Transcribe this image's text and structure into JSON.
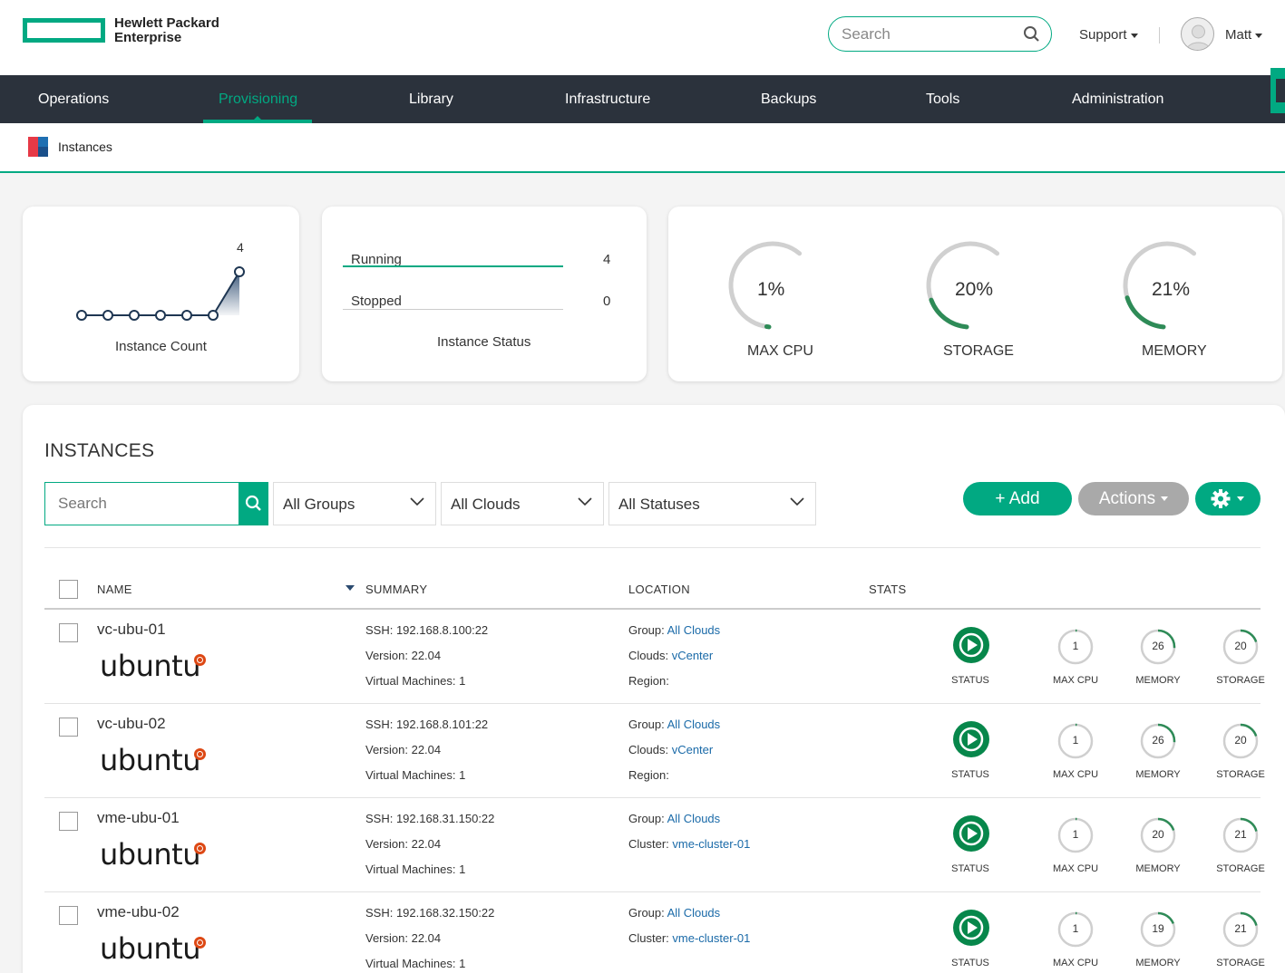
{
  "brand": {
    "line1": "Hewlett Packard",
    "line2": "Enterprise",
    "color": "#01a982"
  },
  "header": {
    "search_placeholder": "Search",
    "support_label": "Support",
    "user_name": "Matt"
  },
  "nav": {
    "items": [
      "Operations",
      "Provisioning",
      "Library",
      "Infrastructure",
      "Backups",
      "Tools",
      "Administration"
    ],
    "active": "Provisioning"
  },
  "breadcrumb": {
    "label": "Instances"
  },
  "summary": {
    "instance_count": {
      "caption": "Instance Count",
      "value_label": "4",
      "series": [
        0,
        0,
        0,
        0,
        0,
        0,
        4
      ]
    },
    "instance_status": {
      "caption": "Instance Status",
      "rows": [
        {
          "label": "Running",
          "value": "4"
        },
        {
          "label": "Stopped",
          "value": "0"
        }
      ]
    },
    "gauges": [
      {
        "label": "MAX CPU",
        "value": "1%",
        "fraction": 0.01
      },
      {
        "label": "STORAGE",
        "value": "20%",
        "fraction": 0.2
      },
      {
        "label": "MEMORY",
        "value": "21%",
        "fraction": 0.21
      }
    ]
  },
  "instances": {
    "title": "INSTANCES",
    "search_placeholder": "Search",
    "filters": {
      "groups": "All Groups",
      "clouds": "All Clouds",
      "statuses": "All Statuses"
    },
    "add_label": "+ Add",
    "actions_label": "Actions",
    "columns": {
      "name": "NAME",
      "summary": "SUMMARY",
      "location": "LOCATION",
      "stats": "STATS"
    },
    "stat_labels": {
      "status": "STATUS",
      "cpu": "MAX CPU",
      "memory": "MEMORY",
      "storage": "STORAGE"
    },
    "os_logo_text": "ubuntu",
    "rows": [
      {
        "name": "vc-ubu-01",
        "ssh": "SSH: 192.168.8.100:22",
        "version": "Version: 22.04",
        "vms": "Virtual Machines: 1",
        "loc1_label": "Group: ",
        "loc1_link": "All Clouds",
        "loc2_label": "Clouds: ",
        "loc2_link": "vCenter",
        "loc3_label": "Region:",
        "cpu": "1",
        "memory": "26",
        "storage": "20"
      },
      {
        "name": "vc-ubu-02",
        "ssh": "SSH: 192.168.8.101:22",
        "version": "Version: 22.04",
        "vms": "Virtual Machines: 1",
        "loc1_label": "Group: ",
        "loc1_link": "All Clouds",
        "loc2_label": "Clouds: ",
        "loc2_link": "vCenter",
        "loc3_label": "Region:",
        "cpu": "1",
        "memory": "26",
        "storage": "20"
      },
      {
        "name": "vme-ubu-01",
        "ssh": "SSH: 192.168.31.150:22",
        "version": "Version: 22.04",
        "vms": "Virtual Machines: 1",
        "loc1_label": "Group: ",
        "loc1_link": "All Clouds",
        "loc2_label": "Cluster: ",
        "loc2_link": "vme-cluster-01",
        "loc3_label": "",
        "cpu": "1",
        "memory": "20",
        "storage": "21"
      },
      {
        "name": "vme-ubu-02",
        "ssh": "SSH: 192.168.32.150:22",
        "version": "Version: 22.04",
        "vms": "Virtual Machines: 1",
        "loc1_label": "Group: ",
        "loc1_link": "All Clouds",
        "loc2_label": "Cluster: ",
        "loc2_link": "vme-cluster-01",
        "loc3_label": "",
        "cpu": "1",
        "memory": "19",
        "storage": "21"
      }
    ]
  }
}
